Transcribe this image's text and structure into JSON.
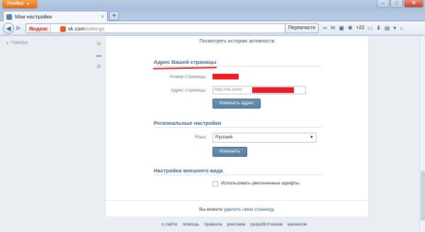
{
  "browser": {
    "menu_button": "Firefox",
    "tab_title": "Мои настройки",
    "new_tab": "+",
    "url_domain": "vk.com",
    "url_path": "/settings",
    "yandex_label": "Яндекс",
    "search_button": "Перекласти",
    "weather_counter": "+22",
    "window_controls": {
      "minimize": "–",
      "maximize": "□",
      "close": "✕"
    }
  },
  "left_rail": {
    "back_to_top": "Наверх"
  },
  "settings": {
    "history_link": "Посмотреть историю активности",
    "address_section": {
      "title": "Адрес Вашей страницы",
      "page_number_label": "Номер страницы:",
      "page_address_label": "Адрес страницы:",
      "address_prefix": "http://vk.com/",
      "change_button": "Изменить адрес"
    },
    "regional_section": {
      "title": "Региональные настройки",
      "language_label": "Язык:",
      "language_value": "Русский",
      "change_button": "Изменить"
    },
    "appearance_section": {
      "title": "Настройки внешнего вида",
      "large_fonts_label": "Использовать увеличенные шрифты",
      "large_fonts_checked": false
    },
    "delete_note_prefix": "Вы можете",
    "delete_note_link": "удалить свою страницу."
  },
  "footer": {
    "links": [
      "о сайте",
      "помощь",
      "правила",
      "реклама",
      "разработчикам",
      "вакансии"
    ]
  },
  "colors": {
    "redaction": "#ee1b24",
    "section_title": "#45688e",
    "button": "#5b7fa6",
    "firefox_button": "#e0691a"
  }
}
